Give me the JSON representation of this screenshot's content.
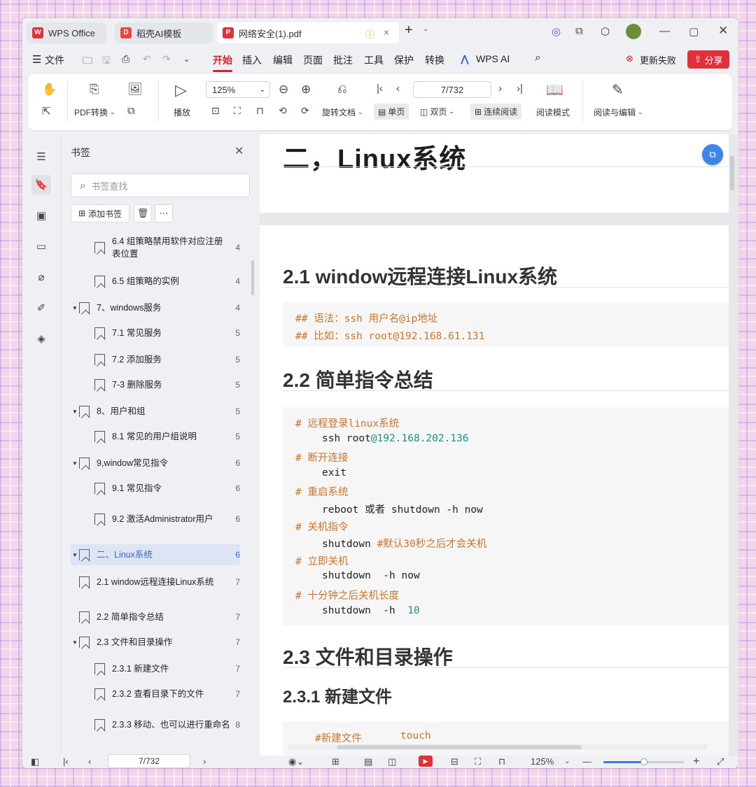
{
  "tabs": [
    {
      "label": "WPS Office",
      "icon": "wps-logo-icon"
    },
    {
      "label": "稻壳AI模板",
      "icon": "docer-icon"
    },
    {
      "label": "网络安全(1).pdf",
      "icon": "pdf-icon"
    }
  ],
  "menu": {
    "file": "文件",
    "items": [
      "开始",
      "插入",
      "编辑",
      "页面",
      "批注",
      "工具",
      "保护",
      "转换"
    ],
    "wps_ai": "WPS AI",
    "update_failed": "更新失败",
    "share": "分享"
  },
  "ribbon": {
    "pdf_convert": "PDF转换",
    "play": "播放",
    "zoom": "125%",
    "rotate": "旋转文档",
    "page_value": "7/732",
    "single_page": "单页",
    "double_page": "双页",
    "continuous": "连续阅读",
    "reading_mode": "阅读模式",
    "read_edit": "阅读与编辑"
  },
  "panel": {
    "title": "书签",
    "search_placeholder": "书签查找",
    "add_bookmark": "添加书签"
  },
  "bookmarks": [
    {
      "text": "6.4 组策略禁用软件对应注册表位置",
      "page": "4",
      "level": 2,
      "toggle": ""
    },
    {
      "text": "6.5 组策略的实例",
      "page": "4",
      "level": 2,
      "toggle": ""
    },
    {
      "text": "7、windows服务",
      "page": "4",
      "level": 1,
      "toggle": "▼"
    },
    {
      "text": "7.1 常见服务",
      "page": "5",
      "level": 2,
      "toggle": ""
    },
    {
      "text": "7.2 添加服务",
      "page": "5",
      "level": 2,
      "toggle": ""
    },
    {
      "text": "7-3 删除服务",
      "page": "5",
      "level": 2,
      "toggle": ""
    },
    {
      "text": "8、用户和组",
      "page": "5",
      "level": 1,
      "toggle": "▼"
    },
    {
      "text": "8.1 常见的用户组说明",
      "page": "5",
      "level": 2,
      "toggle": ""
    },
    {
      "text": "9,window常见指令",
      "page": "6",
      "level": 1,
      "toggle": "▼"
    },
    {
      "text": "9.1 常见指令",
      "page": "6",
      "level": 2,
      "toggle": ""
    },
    {
      "text": "9.2 激活Administrator用户",
      "page": "6",
      "level": 2,
      "toggle": ""
    },
    {
      "text": "二、Linux系统",
      "page": "6",
      "level": 0,
      "toggle": "▼",
      "active": true
    },
    {
      "text": "2.1 window远程连接Linux系统",
      "page": "7",
      "level": 1,
      "toggle": ""
    },
    {
      "text": "2.2 简单指令总结",
      "page": "7",
      "level": 1,
      "toggle": ""
    },
    {
      "text": "2.3 文件和目录操作",
      "page": "7",
      "level": 1,
      "toggle": "▼"
    },
    {
      "text": "2.3.1 新建文件",
      "page": "7",
      "level": 2,
      "toggle": ""
    },
    {
      "text": "2.3.2 查看目录下的文件",
      "page": "7",
      "level": 2,
      "toggle": ""
    },
    {
      "text": "2.3.3 移动、也可以进行重命名",
      "page": "8",
      "level": 2,
      "toggle": ""
    }
  ],
  "doc": {
    "h1": "二，Linux系统",
    "h2_1": "2.1 window远程连接Linux系统",
    "code1": [
      {
        "comment": "## 语法：ssh 用户名@ip地址"
      },
      {
        "comment": "## 比如：ssh root@192.168.61.131"
      }
    ],
    "h2_2": "2.2 简单指令总结",
    "code2": [
      {
        "c": "# 远程登录linux系统"
      },
      {
        "t": "ssh root",
        "n": "@192.168.202.136"
      },
      {
        "c": "# 断开连接"
      },
      {
        "t": "exit"
      },
      {
        "c": "# 重启系统"
      },
      {
        "t": "reboot 或者 shutdown -h now"
      },
      {
        "c": "# 关机指令"
      },
      {
        "t": "shutdown ",
        "c2": "#默认30秒之后才会关机"
      },
      {
        "c": "# 立即关机"
      },
      {
        "t": "shutdown  -h now"
      },
      {
        "c": "# 十分钟之后关机长度"
      },
      {
        "t": "shutdown  -h  ",
        "n": "10"
      }
    ],
    "h2_3": "2.3 文件和目录操作",
    "h3_1": "2.3.1 新建文件",
    "code3": {
      "comment": "#新建文件",
      "cmd": "touch"
    }
  },
  "status": {
    "page": "7/732",
    "zoom": "125%",
    "zoom_level": 0.5
  },
  "colors": {
    "accent": "#d6202b",
    "link": "#3569d6",
    "comment": "#c9762a",
    "number": "#19908a"
  }
}
